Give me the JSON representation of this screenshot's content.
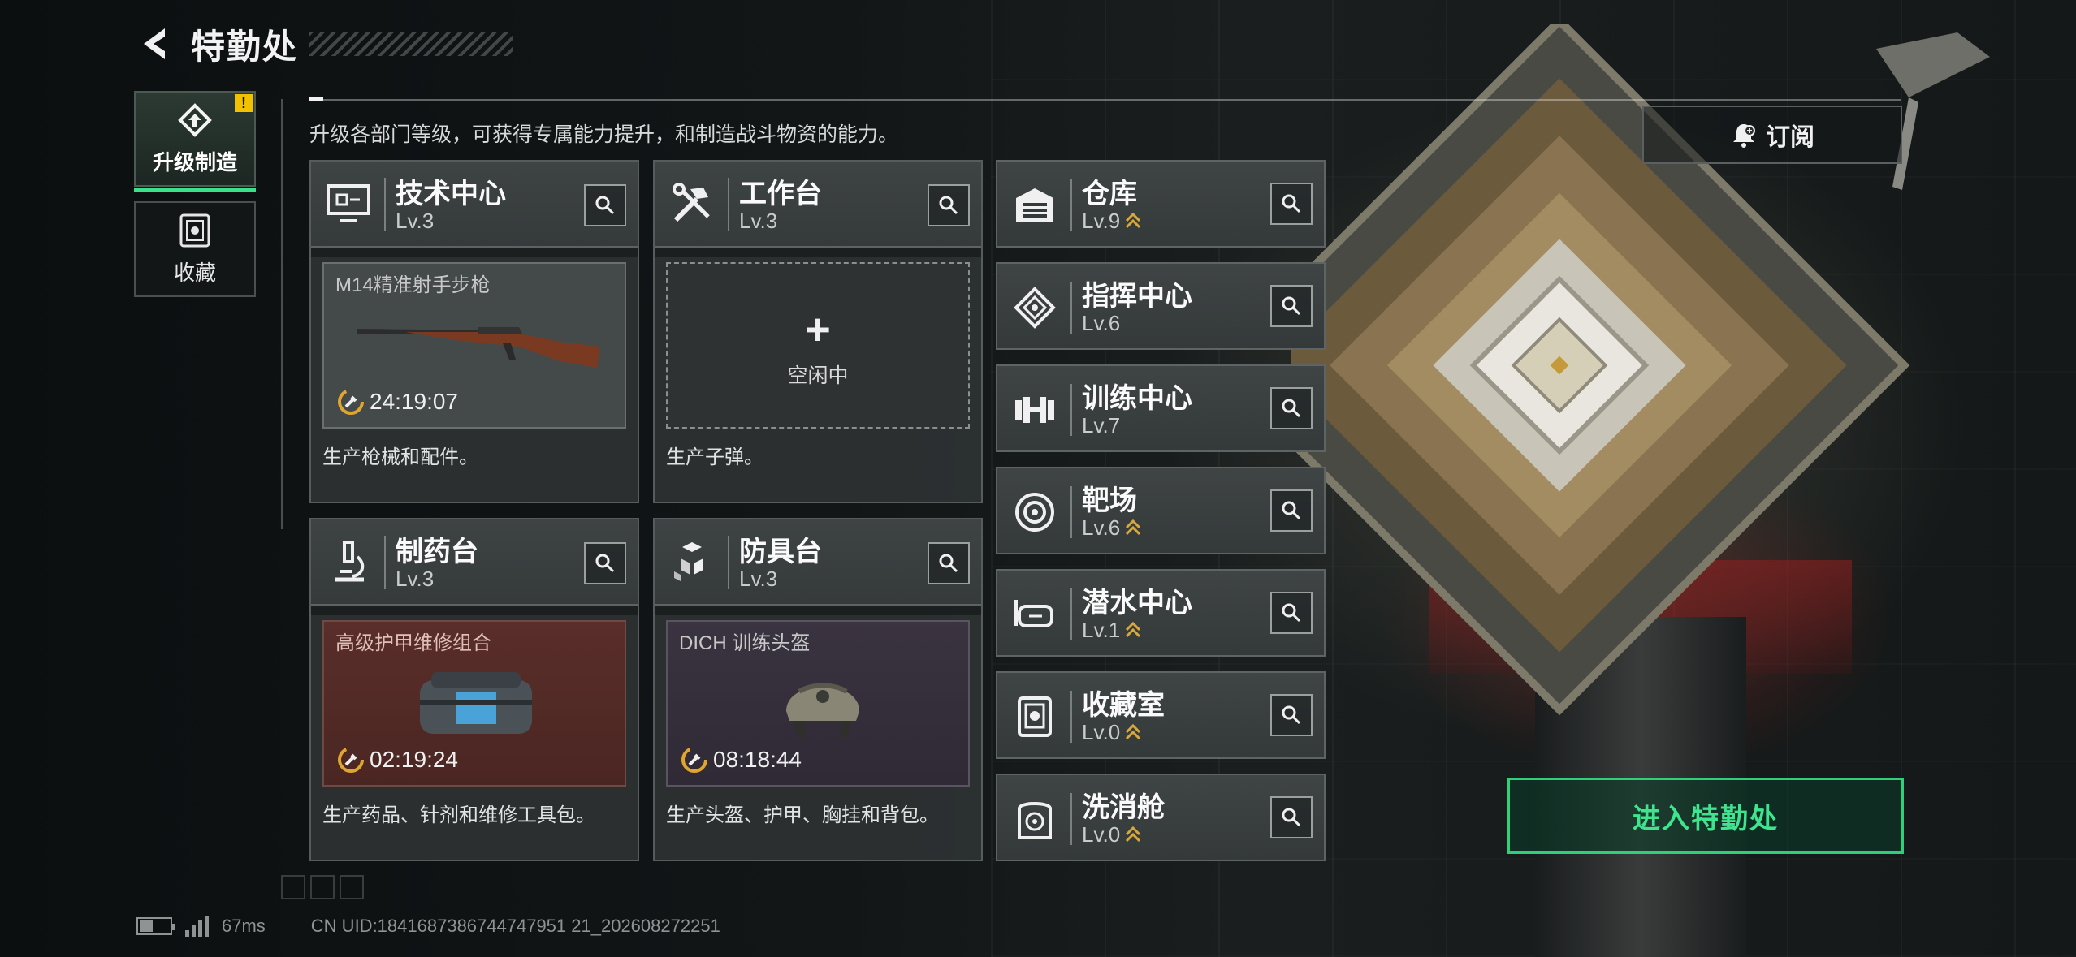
{
  "header": {
    "title": "特勤处"
  },
  "nav": {
    "upgrade_label": "升级制造",
    "collection_label": "收藏",
    "alert": "!"
  },
  "description": "升级各部门等级，可获得专属能力提升，和制造战斗物资的能力。",
  "subscribe_label": "订阅",
  "enter_label": "进入特勤处",
  "cards": [
    {
      "name": "技术中心",
      "level": "Lv.3",
      "slot_name": "M14精准射手步枪",
      "timer": "24:19:07",
      "desc": "生产枪械和配件。",
      "icon": "monitor-icon"
    },
    {
      "name": "工作台",
      "level": "Lv.3",
      "idle_plus": "+",
      "idle_text": "空闲中",
      "desc": "生产子弹。",
      "icon": "tools-icon"
    },
    {
      "name": "制药台",
      "level": "Lv.3",
      "slot_name": "高级护甲维修组合",
      "timer": "02:19:24",
      "desc": "生产药品、针剂和维修工具包。",
      "icon": "microscope-icon"
    },
    {
      "name": "防具台",
      "level": "Lv.3",
      "slot_name": "DICH 训练头盔",
      "timer": "08:18:44",
      "desc": "生产头盔、护甲、胸挂和背包。",
      "icon": "blocks-icon"
    }
  ],
  "facilities": [
    {
      "name": "仓库",
      "level": "Lv.9",
      "upgradable": true,
      "icon": "warehouse-icon"
    },
    {
      "name": "指挥中心",
      "level": "Lv.6",
      "upgradable": false,
      "icon": "command-icon"
    },
    {
      "name": "训练中心",
      "level": "Lv.7",
      "upgradable": false,
      "icon": "dumbbell-icon"
    },
    {
      "name": "靶场",
      "level": "Lv.6",
      "upgradable": true,
      "icon": "target-icon"
    },
    {
      "name": "潜水中心",
      "level": "Lv.1",
      "upgradable": true,
      "icon": "diving-mask-icon"
    },
    {
      "name": "收藏室",
      "level": "Lv.0",
      "upgradable": true,
      "icon": "collection-icon"
    },
    {
      "name": "洗消舱",
      "level": "Lv.0",
      "upgradable": true,
      "icon": "decon-icon"
    }
  ],
  "status": {
    "ping": "67ms",
    "uid": "CN UID:1841687386744747951 21_202608272251"
  },
  "colors": {
    "accent_green": "#3fe48e",
    "upgrade_arrow": "#d9a83a",
    "alert_yellow": "#f2c200"
  }
}
